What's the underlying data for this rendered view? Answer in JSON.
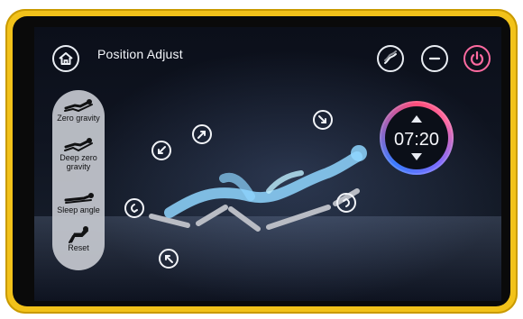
{
  "header": {
    "title": "Position  Adjust"
  },
  "left_menu": [
    {
      "label": "Zero gravity"
    },
    {
      "label": "Deep zero gravity"
    },
    {
      "label": "Sleep angle"
    },
    {
      "label": "Reset"
    }
  ],
  "timer": {
    "value": "07:20"
  },
  "icons": {
    "home": "home-icon",
    "curve": "recline-curve-icon",
    "minus": "minus-icon",
    "power": "power-icon"
  },
  "colors": {
    "frame": "#f2c21a",
    "power": "#ff6aa0",
    "timer_ring_start": "#ff4d7a",
    "timer_ring_end": "#3a7bff"
  }
}
